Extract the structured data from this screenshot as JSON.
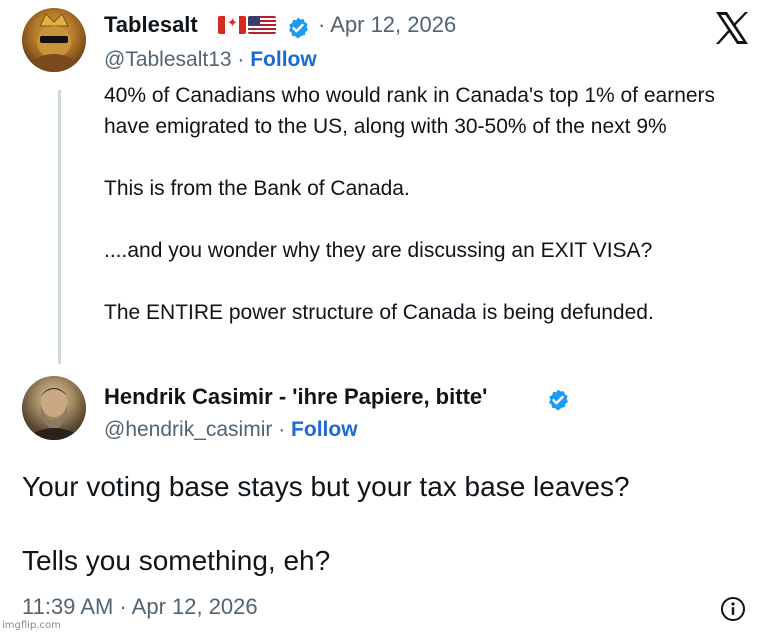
{
  "platform": {
    "logo_icon": "x-logo-icon"
  },
  "original_post": {
    "author_name": "Tablesalt",
    "author_flags": [
      "canada-flag-icon",
      "usa-flag-icon"
    ],
    "verified_icon": "verified-badge-icon",
    "date": "· Apr 12, 2026",
    "handle": "@Tablesalt13",
    "separator": " · ",
    "follow_label": "Follow",
    "text_lines": [
      "40% of Canadians who would rank in Canada's top 1% of earners have emigrated to the US, along with 30-50% of the next 9%",
      "This is from the Bank of Canada.",
      "....and you wonder why they are discussing an EXIT VISA?",
      "The ENTIRE power structure of Canada is being defunded."
    ]
  },
  "reply_post": {
    "author_name": "Hendrik Casimir - 'ihre Papiere, bitte'",
    "verified_icon": "verified-badge-icon",
    "handle": "@hendrik_casimir",
    "separator": " · ",
    "follow_label": "Follow",
    "text_lines": [
      "Your voting base stays but your tax base leaves?",
      "Tells you something, eh?"
    ],
    "timestamp": "11:39 AM · Apr 12, 2026",
    "info_icon": "info-icon"
  },
  "watermark": "imgflip.com",
  "colors": {
    "accent": "#1d9bf0",
    "follow": "#1d6ad4",
    "muted": "#536471",
    "text": "#0f1419"
  }
}
